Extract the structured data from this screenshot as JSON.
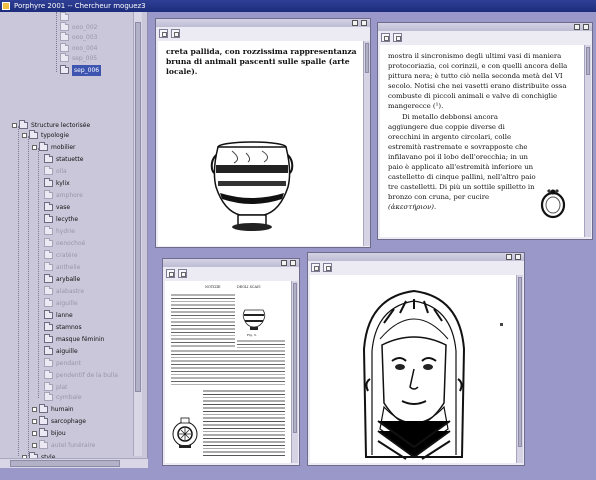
{
  "app": {
    "title": "Porphyre 2001 -- Chercheur moguez3"
  },
  "tree": {
    "items": [
      {
        "label": "",
        "dim": true
      },
      {
        "label": "ooo_002",
        "dim": true
      },
      {
        "label": "ooo_003",
        "dim": true
      },
      {
        "label": "ooo_004",
        "dim": true
      },
      {
        "label": "sep_005",
        "dim": true
      },
      {
        "label": "sep_006",
        "selected": true
      },
      {
        "label": "Structure lectorisée"
      },
      {
        "label": "typologie"
      },
      {
        "label": "mobilier"
      },
      {
        "label": "statuette"
      },
      {
        "label": "olla",
        "dim": true
      },
      {
        "label": "kylix"
      },
      {
        "label": "amphore",
        "dim": true
      },
      {
        "label": "vase"
      },
      {
        "label": "lecythe"
      },
      {
        "label": "hydrie",
        "dim": true
      },
      {
        "label": "oenochoé",
        "dim": true
      },
      {
        "label": "cratère",
        "dim": true
      },
      {
        "label": "anthelie",
        "dim": true
      },
      {
        "label": "aryballe"
      },
      {
        "label": "alabastre",
        "dim": true
      },
      {
        "label": "aiguille",
        "dim": true
      },
      {
        "label": "lanne"
      },
      {
        "label": "stamnos"
      },
      {
        "label": "masque féminin"
      },
      {
        "label": "aiguille"
      },
      {
        "label": "pendant",
        "dim": true
      },
      {
        "label": "pendentif de la bulla",
        "dim": true
      },
      {
        "label": "plat",
        "dim": true
      },
      {
        "label": "cymbale",
        "dim": true
      },
      {
        "label": "humain"
      },
      {
        "label": "sarcophage"
      },
      {
        "label": "bijou"
      },
      {
        "label": "autel funéraire",
        "dim": true
      },
      {
        "label": "style"
      }
    ]
  },
  "doc1": {
    "text": "creta pallida, con rozzissima rappresentanza bruna di animali pascenti sulle spalle (arte locale)."
  },
  "doc2": {
    "text": "mostra il sincronismo degli ultimi vasi di maniera protocoriazia, coi corinzii, e con quelli ancora della pittura nera; è tutto ciò nella seconda metà del VI secolo. Notisi che nei vasetti erano distribuite ossa combuste di piccoli animali e valve di conchiglie mangerecce (¹).",
    "text2": "Di metallo debbonsi ancora aggiungere due coppie diverse di orecchini in argento circolari, colle estremità rastremate e sovrapposte che infilavano poi il lobo dell'orecchia; in un paio è applicato all'estremità inferiore un castelletto di cinque pallini, nell'altro paio tre castelletti. Di più un sottile spilletto in bronzo con cruna, per cucire",
    "greek": "(ἀκεστήριον)."
  },
  "doc3": {
    "header_left": "NOTIZIE",
    "header_right": "DEGLI SCAVI",
    "caption": "Fig. 3."
  }
}
